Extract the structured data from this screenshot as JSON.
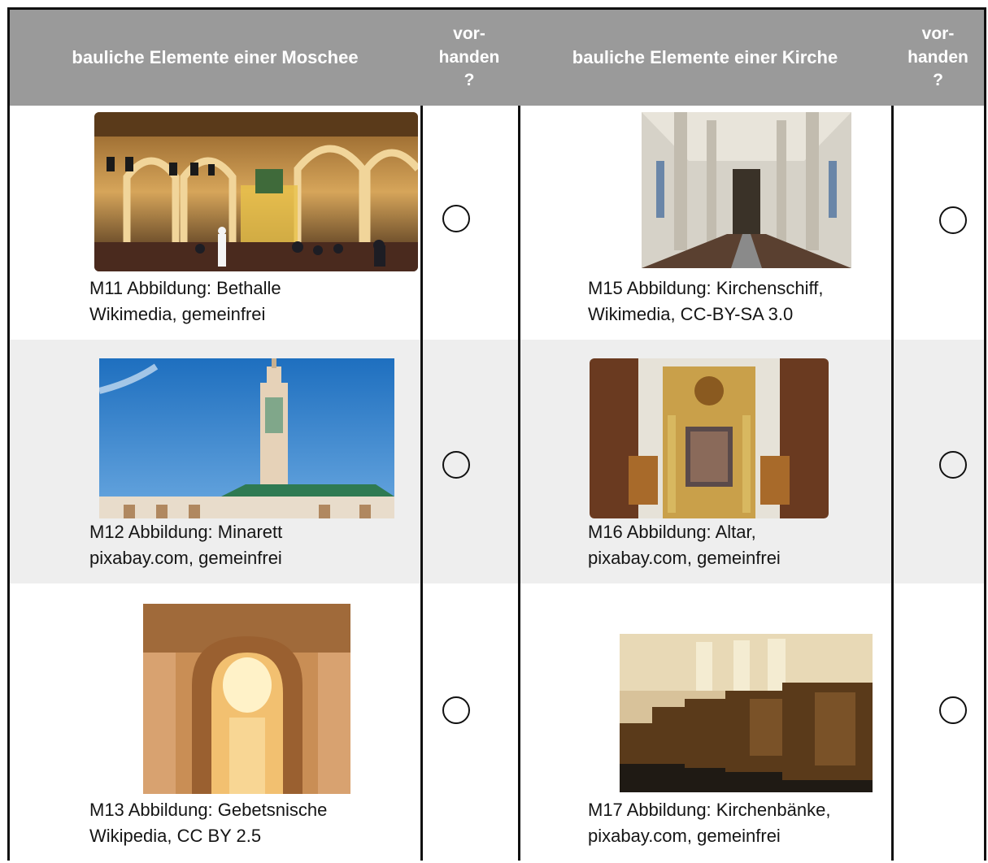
{
  "table": {
    "headers": {
      "mosque": "bauliche Elemente einer Moschee",
      "present_1": [
        "vor-",
        "handen",
        "?"
      ],
      "church": "bauliche Elemente einer Kirche",
      "present_2": [
        "vor-",
        "handen",
        "?"
      ]
    },
    "rows": [
      {
        "mosque": {
          "caption_1": "M11 Abbildung: Bethalle",
          "caption_2": "Wikimedia, gemeinfrei",
          "image": "prayer-hall-photo"
        },
        "church": {
          "caption_1": "M15 Abbildung: Kirchenschiff,",
          "caption_2": "Wikimedia, CC-BY-SA 3.0",
          "image": "nave-photo"
        }
      },
      {
        "mosque": {
          "caption_1": "M12 Abbildung: Minarett",
          "caption_2": "pixabay.com, gemeinfrei",
          "image": "minaret-photo"
        },
        "church": {
          "caption_1": "M16 Abbildung: Altar,",
          "caption_2": "pixabay.com, gemeinfrei",
          "image": "altar-photo"
        }
      },
      {
        "mosque": {
          "caption_1": "M13 Abbildung: Gebetsnische",
          "caption_2": "Wikipedia, CC BY 2.5",
          "image": "prayer-niche-photo"
        },
        "church": {
          "caption_1": "M17 Abbildung: Kirchenbänke,",
          "caption_2": "pixabay.com, gemeinfrei",
          "image": "pews-photo"
        }
      }
    ]
  },
  "colors": {
    "header_bg": "#9a9a9a",
    "header_text": "#ffffff",
    "stripe": "#eeeeee",
    "rule": "#111111"
  }
}
